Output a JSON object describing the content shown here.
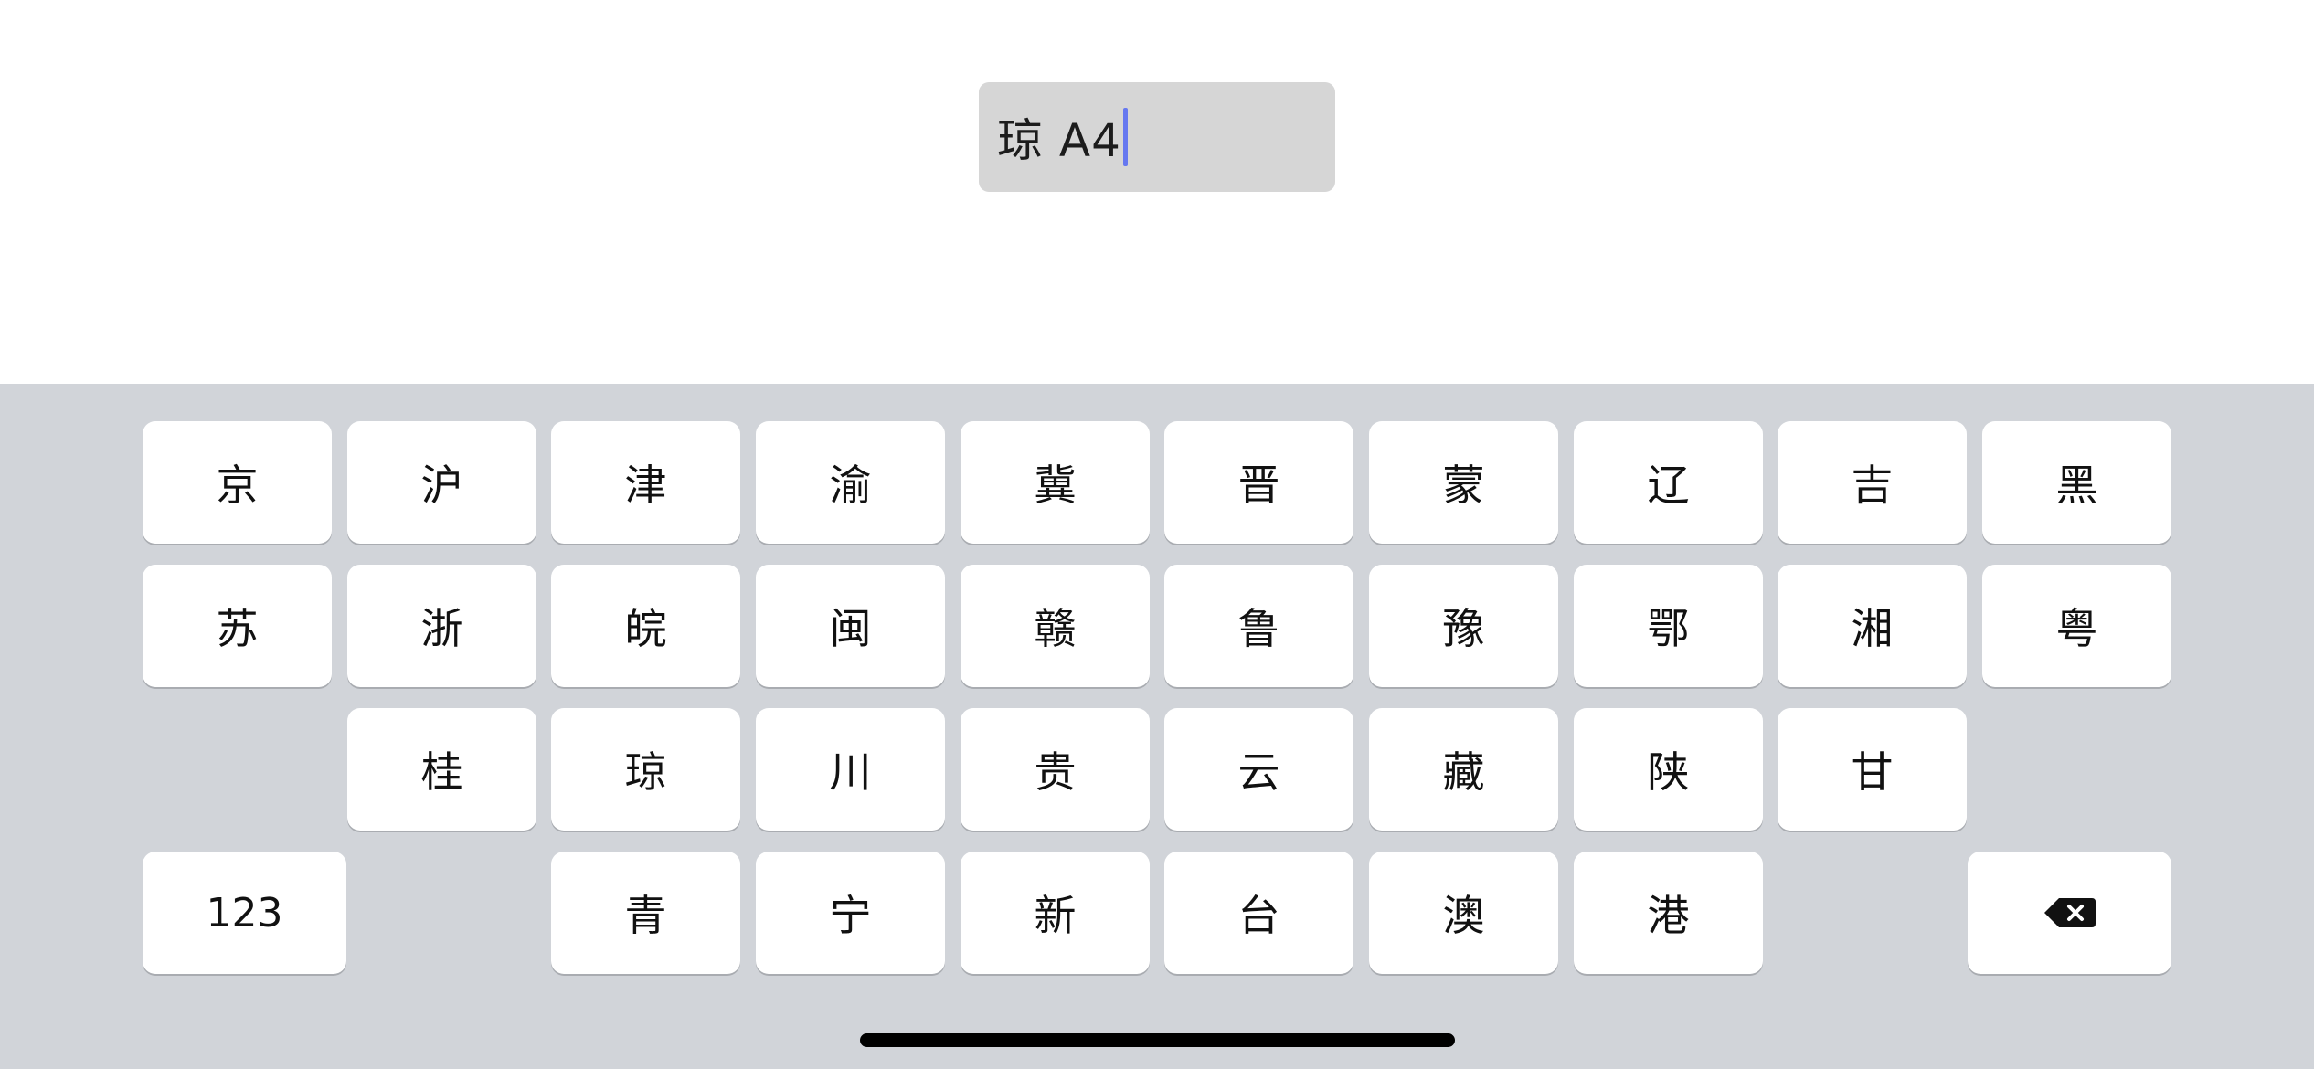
{
  "input": {
    "value": "琼 A4"
  },
  "keyboard": {
    "row1": [
      "京",
      "沪",
      "津",
      "渝",
      "冀",
      "晋",
      "蒙",
      "辽",
      "吉",
      "黑"
    ],
    "row2": [
      "苏",
      "浙",
      "皖",
      "闽",
      "赣",
      "鲁",
      "豫",
      "鄂",
      "湘",
      "粤"
    ],
    "row3": [
      "桂",
      "琼",
      "川",
      "贵",
      "云",
      "藏",
      "陕",
      "甘"
    ],
    "row4": [
      "青",
      "宁",
      "新",
      "台",
      "澳",
      "港"
    ],
    "numbers_key": "123",
    "delete_icon": "delete-backspace-icon"
  },
  "colors": {
    "keyboard_bg": "#d1d4d9",
    "key_bg": "#ffffff",
    "field_bg": "#d6d6d6",
    "caret": "#6678f0"
  }
}
